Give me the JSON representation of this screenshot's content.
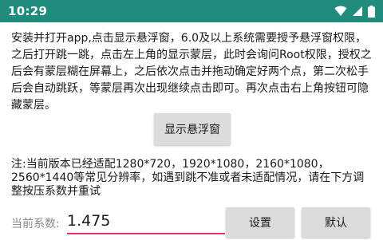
{
  "status_bar": {
    "time": "10:29",
    "bg_color": "#1f8c7d",
    "icons": [
      "wifi-icon",
      "signal-icon",
      "battery-icon"
    ]
  },
  "instructions": "安装并打开app,点击显示悬浮窗，6.0及以上系统需要授予悬浮窗权限，之后打开跳一跳，点击左上角的显示蒙层，此时会询问Root权限，授权之后会有蒙层糊在屏幕上，之后依次点击并拖动确定好两个点，第二次松手后会自动跳跃，等蒙层再次出现继续点击即可。再次点击右上角按钮可隐藏蒙层。",
  "show_floating_button": "显示悬浮窗",
  "note": "注:当前版本已经适配1280*720，1920*1080，2160*1080，2560*1440等常见分辨率，如遇到跳不准或者未适配情况，请在下方调整按压系数并重试",
  "coefficient": {
    "label": "当前系数:",
    "value": "1.475",
    "underline_color": "#e0337a"
  },
  "buttons": {
    "set": "设置",
    "default": "默认"
  }
}
